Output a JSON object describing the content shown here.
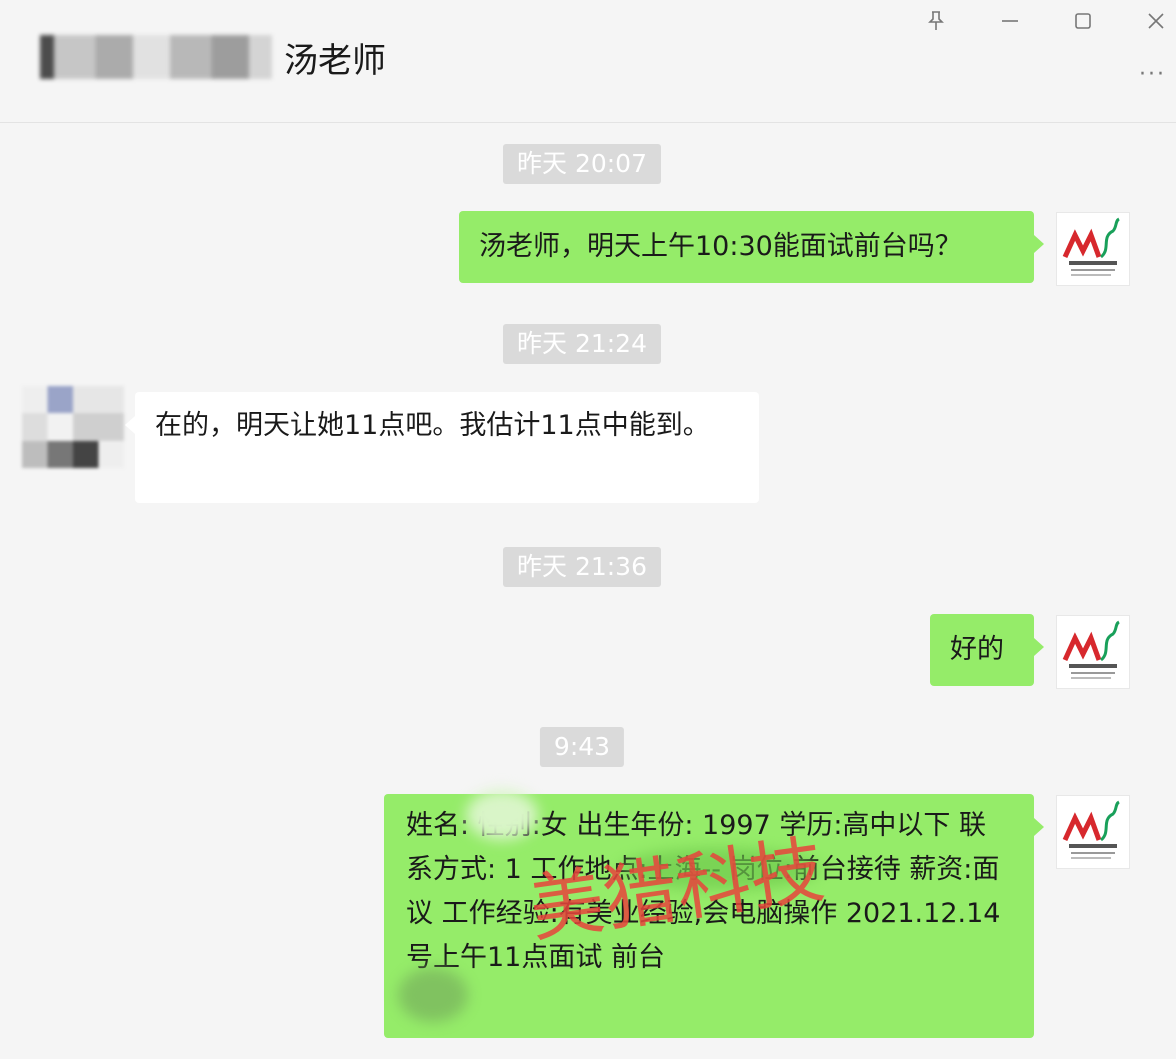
{
  "header": {
    "title_visible": "汤老师",
    "actions": {
      "pin_icon": "pin-icon",
      "minimize_icon": "minimize-icon",
      "maximize_icon": "maximize-icon",
      "close_icon": "close-icon",
      "more_label": "···"
    }
  },
  "messages": [
    {
      "type": "timestamp",
      "text": "昨天 20:07"
    },
    {
      "type": "message",
      "from": "me",
      "text": "汤老师，明天上午10:30能面试前台吗？"
    },
    {
      "type": "timestamp",
      "text": "昨天 21:24"
    },
    {
      "type": "message",
      "from": "other",
      "text": "在的，明天让她11点吧。我估计11点中能到。"
    },
    {
      "type": "timestamp",
      "text": "昨天 21:36"
    },
    {
      "type": "message",
      "from": "me",
      "text": "好的"
    },
    {
      "type": "timestamp",
      "text": "9:43"
    },
    {
      "type": "message",
      "from": "me",
      "text": "姓名:      性别:女 出生年份: 1997 学历:高中以下 联系方式: 1                       工作地点:上海-- 岗位:前台接待 薪资:面议 工作经验:有美业经验,会电脑操作 2021.12.14号上午11点面试      前台"
    }
  ],
  "watermark": "美猎科技",
  "colors": {
    "my_bubble": "#95ec69",
    "other_bubble": "#ffffff",
    "timestamp_bg": "#dadada",
    "background": "#f5f5f5",
    "watermark": "#e8453c"
  }
}
